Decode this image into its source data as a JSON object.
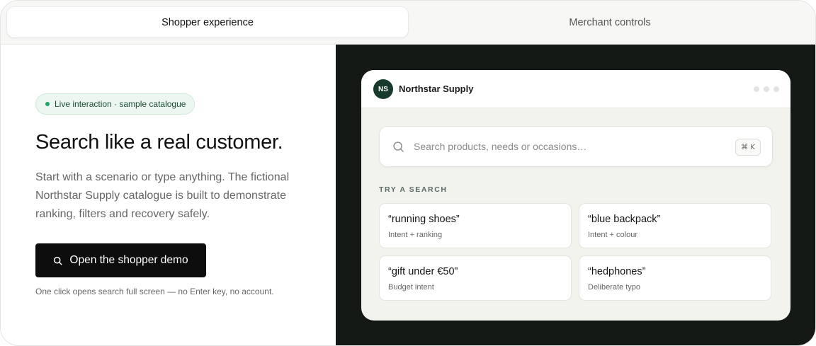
{
  "tabs": [
    {
      "label": "Shopper experience",
      "active": true
    },
    {
      "label": "Merchant controls",
      "active": false
    }
  ],
  "left": {
    "badge": "Live interaction · sample catalogue",
    "headline": "Search like a real customer.",
    "description": "Start with a scenario or type anything. The fictional Northstar Supply catalogue is built to demonstrate ranking, filters and recovery safely.",
    "cta_label": "Open the shopper demo",
    "note": "One click opens search full screen — no Enter key, no account."
  },
  "preview": {
    "avatar_initials": "NS",
    "brand": "Northstar Supply",
    "search_placeholder": "Search products, needs or occasions…",
    "shortcut": "⌘ K",
    "try_label": "TRY A SEARCH",
    "suggestions": [
      {
        "query": "“running shoes”",
        "hint": "Intent + ranking"
      },
      {
        "query": "“blue backpack”",
        "hint": "Intent + colour"
      },
      {
        "query": "“gift under €50”",
        "hint": "Budget intent"
      },
      {
        "query": "“hedphones”",
        "hint": "Deliberate typo"
      }
    ]
  },
  "colors": {
    "dark_panel": "#141915",
    "badge_bg": "#ecf7f1",
    "badge_dot": "#21a567",
    "avatar_bg": "#173a2c",
    "cta_bg": "#0d0d0d"
  }
}
